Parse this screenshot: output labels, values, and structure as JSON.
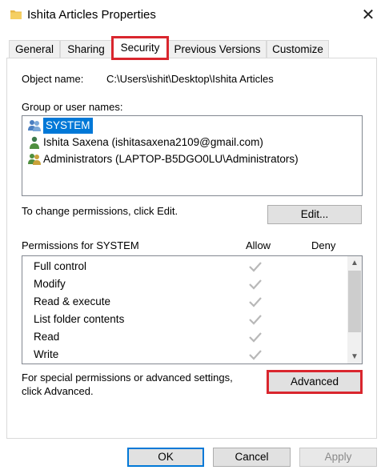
{
  "window": {
    "title": "Ishita Articles Properties",
    "close_label": "✕"
  },
  "tabs": [
    {
      "label": "General",
      "active": false
    },
    {
      "label": "Sharing",
      "active": false
    },
    {
      "label": "Security",
      "active": true
    },
    {
      "label": "Previous Versions",
      "active": false
    },
    {
      "label": "Customize",
      "active": false
    }
  ],
  "security": {
    "object_name_label": "Object name:",
    "object_name_value": "C:\\Users\\ishit\\Desktop\\Ishita Articles",
    "group_label": "Group or user names:",
    "users": [
      {
        "name": "SYSTEM",
        "icon": "group-users-icon",
        "selected": true
      },
      {
        "name": "Ishita Saxena (ishitasaxena2109@gmail.com)",
        "icon": "user-icon",
        "selected": false
      },
      {
        "name": "Administrators (LAPTOP-B5DGO0LU\\Administrators)",
        "icon": "group-users-icon",
        "selected": false
      }
    ],
    "change_hint": "To change permissions, click Edit.",
    "edit_label": "Edit...",
    "permissions_for": "Permissions for SYSTEM",
    "allow_header": "Allow",
    "deny_header": "Deny",
    "permissions": [
      {
        "name": "Full control",
        "allow": true,
        "deny": false
      },
      {
        "name": "Modify",
        "allow": true,
        "deny": false
      },
      {
        "name": "Read & execute",
        "allow": true,
        "deny": false
      },
      {
        "name": "List folder contents",
        "allow": true,
        "deny": false
      },
      {
        "name": "Read",
        "allow": true,
        "deny": false
      },
      {
        "name": "Write",
        "allow": true,
        "deny": false
      }
    ],
    "special_hint_line1": "For special permissions or advanced settings,",
    "special_hint_line2": "click Advanced.",
    "advanced_label": "Advanced"
  },
  "footer": {
    "ok_label": "OK",
    "cancel_label": "Cancel",
    "apply_label": "Apply"
  },
  "colors": {
    "highlight_border": "#d9262e",
    "selection": "#0078d7",
    "check_gray": "#b8b8b8"
  }
}
